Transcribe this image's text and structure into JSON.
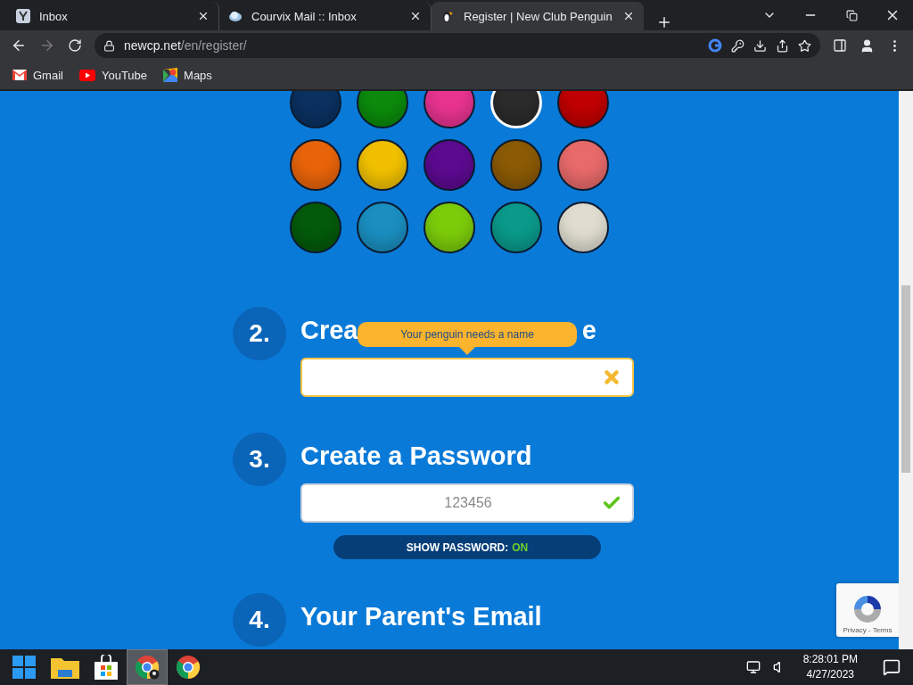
{
  "browser": {
    "tabs": [
      {
        "title": "Inbox",
        "kind": "y",
        "selected": false
      },
      {
        "title": "Courvix Mail :: Inbox",
        "kind": "cloud",
        "selected": false
      },
      {
        "title": "Register | New Club Penguin",
        "kind": "penguin",
        "selected": true
      }
    ],
    "address": {
      "host": "newcp.net",
      "path": "/en/register/"
    },
    "bookmarks": [
      {
        "label": "Gmail",
        "kind": "mail"
      },
      {
        "label": "YouTube",
        "kind": "video"
      },
      {
        "label": "Maps",
        "kind": "map"
      }
    ]
  },
  "page": {
    "colors": [
      {
        "color": "#0a3160",
        "selected": false
      },
      {
        "color": "#0b8a0b",
        "selected": false
      },
      {
        "color": "#e8338f",
        "selected": false
      },
      {
        "color": "#2b2b2b",
        "selected": true
      },
      {
        "color": "#c00000",
        "selected": false
      },
      {
        "color": "#e8640a",
        "selected": false
      },
      {
        "color": "#f0c000",
        "selected": false
      },
      {
        "color": "#5c0a90",
        "selected": false
      },
      {
        "color": "#8a5a05",
        "selected": false
      },
      {
        "color": "#e86a6a",
        "selected": false
      },
      {
        "color": "#035a0a",
        "selected": false
      },
      {
        "color": "#1a8fc0",
        "selected": false
      },
      {
        "color": "#7ccc0a",
        "selected": false
      },
      {
        "color": "#0a9a8a",
        "selected": false
      },
      {
        "color": "#e0ddd0",
        "selected": false
      }
    ],
    "steps": [
      {
        "number": "2.",
        "kind": "name",
        "heading_start": "Crea",
        "heading_end": "e",
        "tooltip": "Your penguin needs a name",
        "valid": false
      },
      {
        "number": "3.",
        "kind": "password",
        "heading": "Create a Password",
        "value": "123456",
        "valid": true,
        "toggle_label": "SHOW PASSWORD:",
        "toggle_state": "ON"
      },
      {
        "number": "4.",
        "kind": "email",
        "heading": "Your Parent's Email"
      }
    ],
    "recaptcha": {
      "links": "Privacy - Terms"
    }
  },
  "taskbar": {
    "apps": [
      {
        "kind": "start",
        "selected": false
      },
      {
        "kind": "folder",
        "selected": false
      },
      {
        "kind": "store",
        "selected": false
      },
      {
        "kind": "chrome-profile",
        "selected": true
      },
      {
        "kind": "chrome",
        "selected": false
      }
    ],
    "clock": {
      "time": "8:28:01 PM",
      "date": "4/27/2023"
    }
  }
}
